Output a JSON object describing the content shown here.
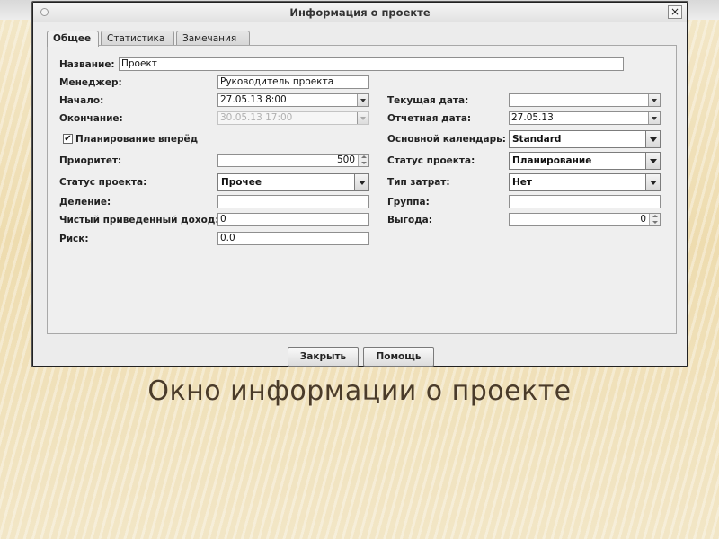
{
  "window": {
    "title": "Информация о проекте",
    "close_label": "×"
  },
  "tabs": [
    {
      "label": "Общее",
      "active": true
    },
    {
      "label": "Статистика",
      "active": false
    },
    {
      "label": "Замечания",
      "active": false
    }
  ],
  "form": {
    "name": {
      "label": "Название:",
      "value": "Проект"
    },
    "manager": {
      "label": "Менеджер:",
      "value": "Руководитель проекта"
    },
    "start": {
      "label": "Начало:",
      "value": "27.05.13 8:00"
    },
    "finish": {
      "label": "Окончание:",
      "value": "30.05.13 17:00"
    },
    "schedule_forward": {
      "label": "Планирование вперёд",
      "checked": true,
      "check_mark": "✔"
    },
    "priority": {
      "label": "Приоритет:",
      "value": "500"
    },
    "project_status": {
      "label": "Статус проекта:",
      "value": "Прочее"
    },
    "division": {
      "label": "Деление:",
      "value": ""
    },
    "npv": {
      "label": "Чистый приведенный доход:",
      "value": "0"
    },
    "risk": {
      "label": "Риск:",
      "value": "0.0"
    },
    "current_date": {
      "label": "Текущая дата:",
      "value": ""
    },
    "status_date": {
      "label": "Отчетная дата:",
      "value": "27.05.13"
    },
    "base_calendar": {
      "label": "Основной календарь:",
      "value": "Standard"
    },
    "project_state": {
      "label": "Статус проекта:",
      "value": "Планирование"
    },
    "expense_type": {
      "label": "Тип затрат:",
      "value": "Нет"
    },
    "group": {
      "label": "Группа:",
      "value": ""
    },
    "benefit": {
      "label": "Выгода:",
      "value": "0"
    }
  },
  "buttons": {
    "close": "Закрыть",
    "help": "Помощь"
  },
  "caption": "Окно информации о проекте"
}
